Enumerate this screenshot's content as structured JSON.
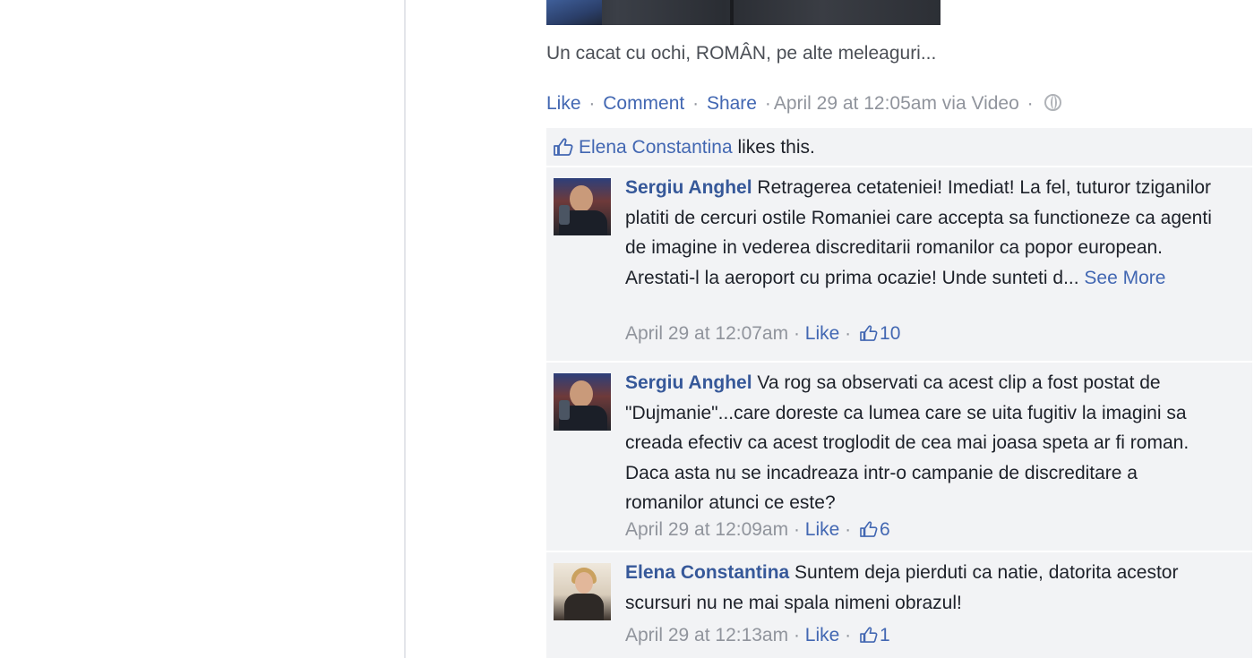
{
  "post": {
    "caption": "Un cacat cu ochi, ROMÂN, pe alte meleaguri...",
    "actions": {
      "like": "Like",
      "comment": "Comment",
      "share": "Share",
      "timestamp": "April 29 at 12:05am via Video",
      "separator": "·"
    },
    "likes_summary": {
      "liker": "Elena Constantina",
      "suffix": "likes this."
    }
  },
  "comments": [
    {
      "author": "Sergiu Anghel",
      "text": "Retragerea cetateniei! Imediat! La fel, tuturor tziganilor platiti de cercuri ostile Romaniei care accepta sa functioneze ca agenti de imagine in vederea discreditarii romanilor ca popor european. Arestati-l la aeroport cu prima ocazie! Unde sunteti d...",
      "see_more": "See More",
      "timestamp": "April 29 at 12:07am",
      "like_label": "Like",
      "like_count": "10"
    },
    {
      "author": "Sergiu Anghel",
      "text": "Va rog sa observati ca acest clip a fost postat de \"Dujmanie\"...care doreste ca lumea care se uita fugitiv la imagini sa creada efectiv ca acest troglodit de cea mai joasa speta ar fi roman. Daca asta nu se incadreaza intr-o campanie de discreditare a romanilor atunci ce este?",
      "timestamp": "April 29 at 12:09am",
      "like_label": "Like",
      "like_count": "6"
    },
    {
      "author": "Elena Constantina",
      "text": "Suntem deja pierduti ca natie, datorita acestor scursuri nu ne mai spala nimeni obrazul!",
      "timestamp": "April 29 at 12:13am",
      "like_label": "Like",
      "like_count": "1"
    }
  ],
  "colors": {
    "link": "#4267b2",
    "author": "#365899",
    "meta": "#90949c",
    "thread_bg": "#f2f3f5"
  }
}
